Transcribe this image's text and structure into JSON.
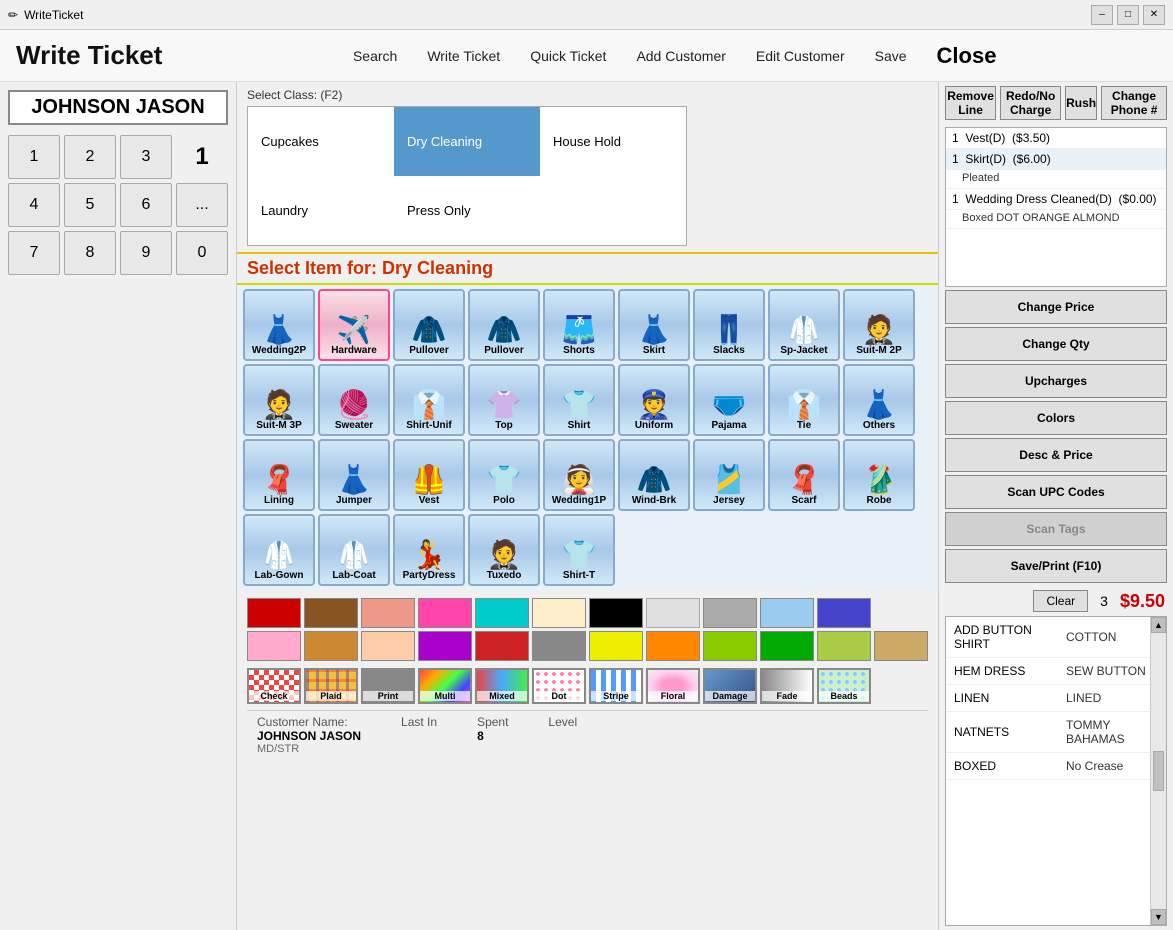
{
  "titleBar": {
    "appName": "WriteTicket",
    "minimize": "–",
    "maximize": "□",
    "close": "✕"
  },
  "menuBar": {
    "appTitle": "Write Ticket",
    "items": [
      "Search",
      "Write Ticket",
      "Quick Ticket",
      "Add Customer",
      "Edit Customer",
      "Save",
      "Close"
    ]
  },
  "customer": {
    "name": "JOHNSON JASON"
  },
  "numpad": {
    "buttons": [
      [
        "1",
        "2",
        "3",
        "1"
      ],
      [
        "4",
        "5",
        "6",
        "..."
      ],
      [
        "7",
        "8",
        "9",
        "0"
      ]
    ],
    "display": "1"
  },
  "classSelector": {
    "label": "Select Class: (F2)",
    "items": [
      {
        "id": "cupcakes",
        "label": "Cupcakes"
      },
      {
        "id": "dry-cleaning",
        "label": "Dry Cleaning",
        "selected": true
      },
      {
        "id": "house-hold",
        "label": "House Hold"
      },
      {
        "id": "laundry",
        "label": "Laundry"
      },
      {
        "id": "press-only",
        "label": "Press Only"
      },
      {
        "id": "empty",
        "label": ""
      }
    ]
  },
  "selectItemHeader": "Select Item for: Dry Cleaning",
  "items": [
    {
      "id": "wedding2p",
      "label": "Wedding2P",
      "icon": "👗"
    },
    {
      "id": "hardware",
      "label": "Hardware",
      "icon": "✈",
      "selected": true
    },
    {
      "id": "pullover1",
      "label": "Pullover",
      "icon": "🧥"
    },
    {
      "id": "pullover2",
      "label": "Pullover",
      "icon": "🧥"
    },
    {
      "id": "shorts",
      "label": "Shorts",
      "icon": "🩳"
    },
    {
      "id": "skirt",
      "label": "Skirt",
      "icon": "👗"
    },
    {
      "id": "slacks",
      "label": "Slacks",
      "icon": "👖"
    },
    {
      "id": "sp-jacket",
      "label": "Sp-Jacket",
      "icon": "🥼"
    },
    {
      "id": "suit-m2p",
      "label": "Suit-M 2P",
      "icon": "🤵"
    },
    {
      "id": "suit-m3p",
      "label": "Suit-M 3P",
      "icon": "🤵"
    },
    {
      "id": "sweater",
      "label": "Sweater",
      "icon": "🧶"
    },
    {
      "id": "shirt-unif",
      "label": "Shirt-Unif",
      "icon": "👔"
    },
    {
      "id": "top",
      "label": "Top",
      "icon": "👚"
    },
    {
      "id": "shirt",
      "label": "Shirt",
      "icon": "👕"
    },
    {
      "id": "uniform",
      "label": "Uniform",
      "icon": "👮"
    },
    {
      "id": "pajama",
      "label": "Pajama",
      "icon": "🩲"
    },
    {
      "id": "tie",
      "label": "Tie",
      "icon": "👔"
    },
    {
      "id": "others",
      "label": "Others",
      "icon": "👗"
    },
    {
      "id": "lining",
      "label": "Lining",
      "icon": "🧣"
    },
    {
      "id": "jumper",
      "label": "Jumper",
      "icon": "👗"
    },
    {
      "id": "vest",
      "label": "Vest",
      "icon": "🦺"
    },
    {
      "id": "polo",
      "label": "Polo",
      "icon": "👕"
    },
    {
      "id": "wedding1p",
      "label": "Wedding1P",
      "icon": "👰"
    },
    {
      "id": "wind-brk",
      "label": "Wind-Brk",
      "icon": "🧥"
    },
    {
      "id": "jersey",
      "label": "Jersey",
      "icon": "🎽"
    },
    {
      "id": "scarf",
      "label": "Scarf",
      "icon": "🧣"
    },
    {
      "id": "robe",
      "label": "Robe",
      "icon": "🥻"
    },
    {
      "id": "lab-gown",
      "label": "Lab-Gown",
      "icon": "🥼"
    },
    {
      "id": "lab-coat",
      "label": "Lab-Coat",
      "icon": "🥼"
    },
    {
      "id": "partydress",
      "label": "PartyDress",
      "icon": "💃"
    },
    {
      "id": "tuxedo",
      "label": "Tuxedo",
      "icon": "🤵"
    },
    {
      "id": "shirt-t",
      "label": "Shirt-T",
      "icon": "👕"
    }
  ],
  "colors": {
    "label": "Colors",
    "swatches": [
      "#cc0000",
      "#885522",
      "#ee9988",
      "#ff44aa",
      "#00cccc",
      "#ffeecc",
      "#000000",
      "",
      "#aaaaaa",
      "#99ccee",
      "#4444cc",
      "#ffaacc",
      "#cc8833",
      "#ffccaa",
      "#aa00cc",
      "#cc2222",
      "#888888",
      "#eeee00",
      "#ff8800",
      "#88cc00",
      "#00aa00",
      "#aacc44",
      "#ccaa66"
    ],
    "patterns": [
      {
        "id": "check",
        "label": "Check",
        "class": "check-pattern"
      },
      {
        "id": "plaid",
        "label": "Plaid",
        "class": "plaid-pattern"
      },
      {
        "id": "print",
        "label": "Print",
        "class": "print-pattern"
      },
      {
        "id": "multi",
        "label": "Multi",
        "class": "multi-pattern"
      },
      {
        "id": "mixed",
        "label": "Mixed",
        "class": "mixed-pattern"
      },
      {
        "id": "dot",
        "label": "Dot",
        "class": "dot-pattern"
      },
      {
        "id": "stripe",
        "label": "Stripe",
        "class": "stripe-pattern"
      },
      {
        "id": "floral",
        "label": "Floral",
        "class": "floral-pattern"
      },
      {
        "id": "damage",
        "label": "Damage",
        "class": "damage-pattern"
      },
      {
        "id": "fade",
        "label": "Fade",
        "class": "fade-pattern"
      },
      {
        "id": "beads",
        "label": "Beads",
        "class": "beads-pattern"
      }
    ]
  },
  "customerInfo": {
    "nameLabel": "Customer Name:",
    "name": "JOHNSON JASON",
    "lastInLabel": "Last In",
    "spentLabel": "Spent",
    "spentValue": "8",
    "levelLabel": "Level",
    "extraInfo": "MD/STR"
  },
  "rightPanel": {
    "actionButtons": [
      {
        "id": "remove-line",
        "label": "Remove Line"
      },
      {
        "id": "redo-no-charge",
        "label": "Redo/No Charge"
      },
      {
        "id": "rush",
        "label": "Rush"
      },
      {
        "id": "change-phone",
        "label": "Change Phone #"
      }
    ],
    "middleButtons": [
      {
        "id": "change-price",
        "label": "Change Price"
      },
      {
        "id": "change-qty",
        "label": "Change Qty"
      },
      {
        "id": "upcharges",
        "label": "Upcharges"
      },
      {
        "id": "colors",
        "label": "Colors"
      },
      {
        "id": "desc-price",
        "label": "Desc & Price"
      },
      {
        "id": "scan-upc",
        "label": "Scan UPC Codes"
      },
      {
        "id": "scan-tags",
        "label": "Scan Tags"
      }
    ],
    "orderItems": [
      {
        "qty": "1",
        "name": "Vest(D)",
        "price": "($3.50)",
        "alt": false
      },
      {
        "qty": "1",
        "name": "Skirt(D)",
        "price": "($6.00)",
        "alt": true
      },
      {
        "note": "Pleated",
        "alt": true
      },
      {
        "qty": "1",
        "name": "Wedding Dress Cleaned(D)",
        "price": "($0.00)",
        "alt": false
      },
      {
        "note": "Boxed DOT ORANGE ALMOND",
        "alt": false
      }
    ],
    "totalCount": "3",
    "totalAmount": "$9.50",
    "clearLabel": "Clear",
    "saveLabel": "Save/Print (F10)",
    "options": [
      {
        "name": "ADD BUTTON SHIRT",
        "value": "COTTON"
      },
      {
        "name": "HEM DRESS",
        "value": "SEW BUTTON"
      },
      {
        "name": "LINEN",
        "value": "LINED"
      },
      {
        "name": "NATNETS",
        "value": "TOMMY BAHAMAS"
      },
      {
        "name": "BOXED",
        "value": "No Crease"
      }
    ]
  }
}
